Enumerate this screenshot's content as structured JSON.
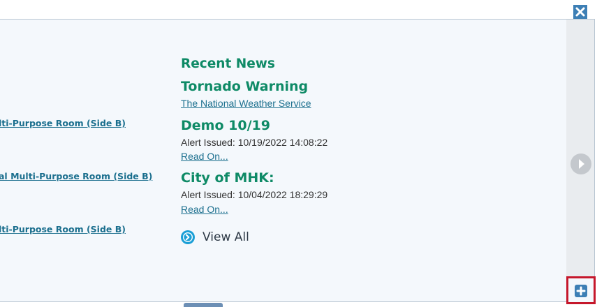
{
  "events": [
    {
      "location": "lti-Purpose Room (Side B)"
    },
    {
      "location": "al Multi-Purpose Room (Side B)"
    },
    {
      "location": "lti-Purpose Room (Side B)"
    }
  ],
  "news": {
    "heading": "Recent News",
    "items": [
      {
        "title": "Tornado Warning",
        "source_link": "The National Weather Service"
      },
      {
        "title": "Demo 10/19",
        "meta": "Alert Issued: 10/19/2022 14:08:22",
        "link": "Read On..."
      },
      {
        "title": "City of MHK:",
        "meta": "Alert Issued: 10/04/2022 18:29:29",
        "link": "Read On..."
      }
    ],
    "view_all_label": "View All"
  },
  "icons": {
    "close": "close-icon",
    "next": "chevron-right-icon",
    "add": "plus-icon",
    "view_all": "chevron-right-circle-icon"
  },
  "colors": {
    "accent_green": "#0e8a66",
    "link_blue": "#1b6f8e",
    "close_blue": "#3d7fb5",
    "highlight_red": "#c5172b"
  }
}
